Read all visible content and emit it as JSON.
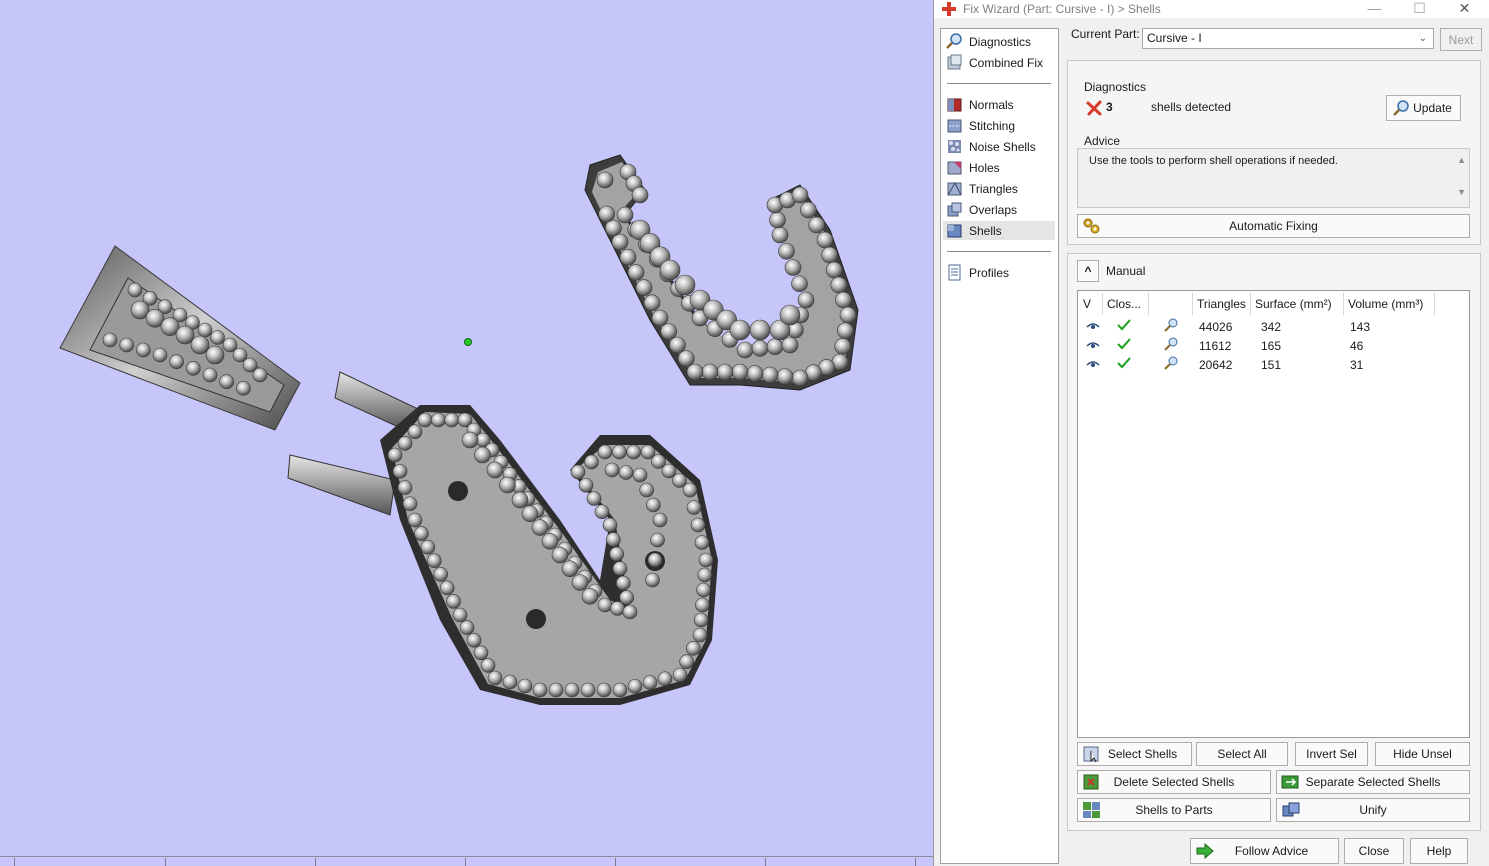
{
  "window": {
    "title": "Fix Wizard (Part: Cursive - I) > Shells",
    "minimize": "—",
    "maximize": "☐",
    "close": "✕"
  },
  "nav": {
    "items": [
      {
        "label": "Diagnostics",
        "icon": "magnifier-icon"
      },
      {
        "label": "Combined Fix",
        "icon": "combined-fix-icon"
      },
      {
        "label": "Normals",
        "icon": "normals-icon"
      },
      {
        "label": "Stitching",
        "icon": "stitching-icon"
      },
      {
        "label": "Noise Shells",
        "icon": "noise-shells-icon"
      },
      {
        "label": "Holes",
        "icon": "holes-icon"
      },
      {
        "label": "Triangles",
        "icon": "triangles-icon"
      },
      {
        "label": "Overlaps",
        "icon": "overlaps-icon"
      },
      {
        "label": "Shells",
        "icon": "shells-icon",
        "active": true
      },
      {
        "label": "Profiles",
        "icon": "profiles-icon"
      }
    ]
  },
  "current_part": {
    "label": "Current Part:",
    "value": "Cursive - I",
    "next": "Next"
  },
  "diagnostics": {
    "heading": "Diagnostics",
    "count": "3",
    "message": "shells detected",
    "update": "Update"
  },
  "advice": {
    "heading": "Advice",
    "text": "Use the tools to perform shell operations if needed.",
    "automatic_fixing": "Automatic Fixing"
  },
  "manual": {
    "heading": "Manual",
    "columns": [
      "V",
      "Clos...",
      "",
      "Triangles",
      "Surface (mm²)",
      "Volume (mm³)"
    ],
    "rows": [
      {
        "triangles": "44026",
        "surface": "342",
        "volume": "143"
      },
      {
        "triangles": "11612",
        "surface": "165",
        "volume": "46"
      },
      {
        "triangles": "20642",
        "surface": "151",
        "volume": "31"
      }
    ],
    "buttons": {
      "select_shells": "Select Shells",
      "select_all": "Select All",
      "invert_sel": "Invert Sel",
      "hide_unsel": "Hide Unsel",
      "delete_selected": "Delete Selected Shells",
      "separate_selected": "Separate Selected Shells",
      "shells_to_parts": "Shells to Parts",
      "unify": "Unify"
    }
  },
  "footer": {
    "follow_advice": "Follow Advice",
    "close": "Close",
    "help": "Help"
  },
  "colors": {
    "viewport_bg": "#c6c6fa",
    "error_red": "#d63a2a",
    "check_green": "#1aa11a"
  }
}
